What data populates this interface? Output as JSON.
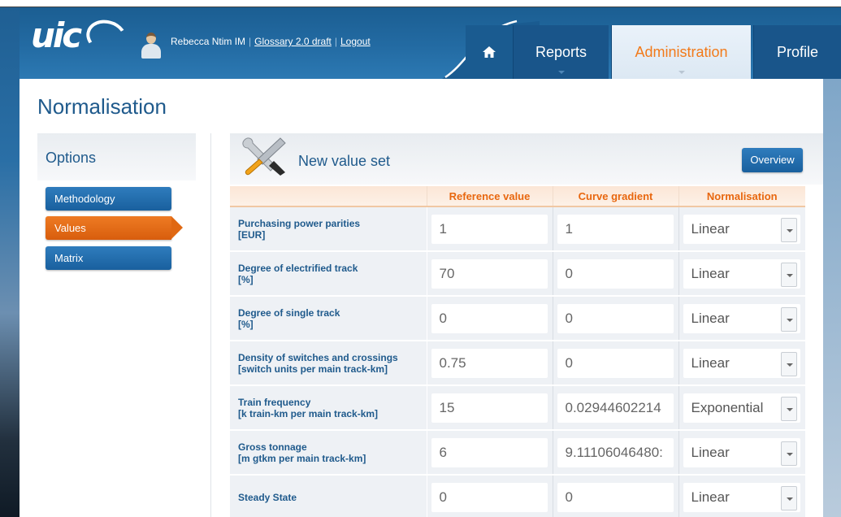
{
  "header": {
    "logo_text": "uic",
    "user_name": "Rebecca Ntim IM",
    "glossary_link": "Glossary 2.0 draft",
    "logout_link": "Logout",
    "nav": {
      "home_icon": "home-icon",
      "reports": "Reports",
      "administration": "Administration",
      "profile": "Profile"
    }
  },
  "page": {
    "title": "Normalisation"
  },
  "sidebar": {
    "heading": "Options",
    "items": [
      {
        "label": "Methodology",
        "active": false
      },
      {
        "label": "Values",
        "active": true
      },
      {
        "label": "Matrix",
        "active": false
      }
    ]
  },
  "panel": {
    "title": "New value set",
    "overview_button": "Overview",
    "icon": "tools-icon"
  },
  "table": {
    "columns": [
      "",
      "Reference value",
      "Curve gradient",
      "Normalisation"
    ],
    "rows": [
      {
        "name": "Purchasing power parities",
        "unit": "[EUR]",
        "reference": "1",
        "gradient": "1",
        "normalisation": "Linear"
      },
      {
        "name": "Degree of electrified track",
        "unit": "[%]",
        "reference": "70",
        "gradient": "0",
        "normalisation": "Linear"
      },
      {
        "name": "Degree of single track",
        "unit": "[%]",
        "reference": "0",
        "gradient": "0",
        "normalisation": "Linear"
      },
      {
        "name": "Density of switches and crossings",
        "unit": "[switch units per main track-km]",
        "reference": "0.75",
        "gradient": "0",
        "normalisation": "Linear"
      },
      {
        "name": "Train frequency",
        "unit": "[k train-km per main track-km]",
        "reference": "15",
        "gradient": "0.02944602214",
        "normalisation": "Exponential"
      },
      {
        "name": "Gross tonnage",
        "unit": "[m gtkm per main track-km]",
        "reference": "6",
        "gradient": "9.11106046480:",
        "normalisation": "Linear"
      },
      {
        "name": "Steady State",
        "unit": "",
        "reference": "0",
        "gradient": "0",
        "normalisation": "Linear"
      }
    ]
  },
  "colors": {
    "primary_blue": "#1f5a8c",
    "accent_orange": "#f27a1a"
  }
}
